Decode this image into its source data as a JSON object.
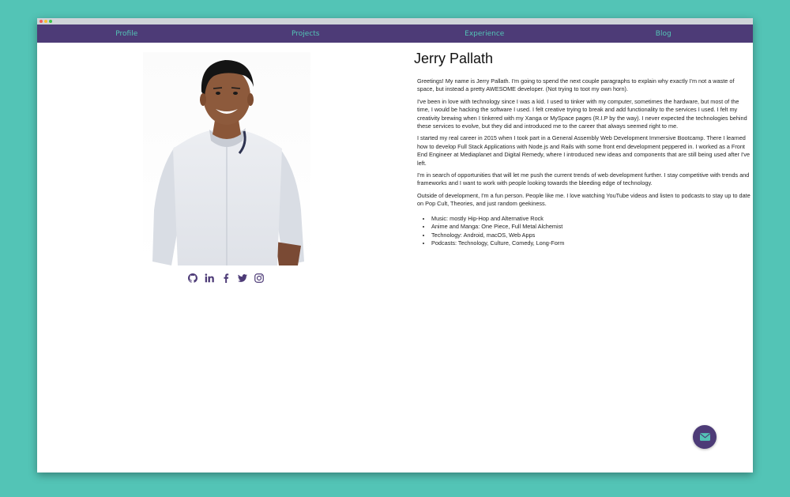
{
  "colors": {
    "background": "#53c4b6",
    "navbar": "#4d3b77",
    "nav_text": "#53c4b6",
    "accent": "#4d3b77"
  },
  "nav": {
    "items": [
      {
        "label": "Profile"
      },
      {
        "label": "Projects"
      },
      {
        "label": "Experience"
      },
      {
        "label": "Blog"
      }
    ]
  },
  "profile": {
    "name": "Jerry Pallath",
    "photo_alt": "portrait photo",
    "social": [
      {
        "icon": "github-icon"
      },
      {
        "icon": "linkedin-icon"
      },
      {
        "icon": "facebook-icon"
      },
      {
        "icon": "twitter-icon"
      },
      {
        "icon": "instagram-icon"
      }
    ],
    "paragraphs": [
      "Greetings! My name is Jerry Pallath. I'm going to spend the next couple paragraphs to explain why exactly I'm not a waste of space, but instead a pretty AWESOME developer. (Not trying to toot my own horn).",
      "I've been in love with technology since I was a kid. I used to tinker with my computer, sometimes the hardware, but most of the time, I would be hacking the software I used. I felt creative trying to break and add functionality to the services I used. I felt my creativity brewing when I tinkered with my Xanga or MySpace pages (R.I.P by the way). I never expected the technologies behind these services to evolve, but they did and introduced me to the career that always seemed right to me.",
      "I started my real career in 2015 when I took part in a General Assembly Web Development Immersive Bootcamp. There I learned how to develop Full Stack Applications with Node.js and Rails with some front end development peppered in. I worked as a Front End Engineer at Mediaplanet and Digital Remedy, where I introduced new ideas and components that are still being used after I've left.",
      "I'm in search of opportunities that will let me push the current trends of web development further. I stay competitive with trends and frameworks and I want to work with people looking towards the bleeding edge of technology.",
      "Outside of development, I'm a fun person. People like me. I love watching YouTube videos and listen to podcasts to stay up to date on Pop Cult, Theories, and just random geekiness."
    ],
    "interests": [
      "Music: mostly Hip-Hop and Alternative Rock",
      "Anime and Manga: One Piece, Full Metal Alchemist",
      "Technology: Android, macOS, Web Apps",
      "Podcasts: Technology, Culture, Comedy, Long-Form"
    ]
  },
  "fab": {
    "icon": "envelope-icon"
  }
}
